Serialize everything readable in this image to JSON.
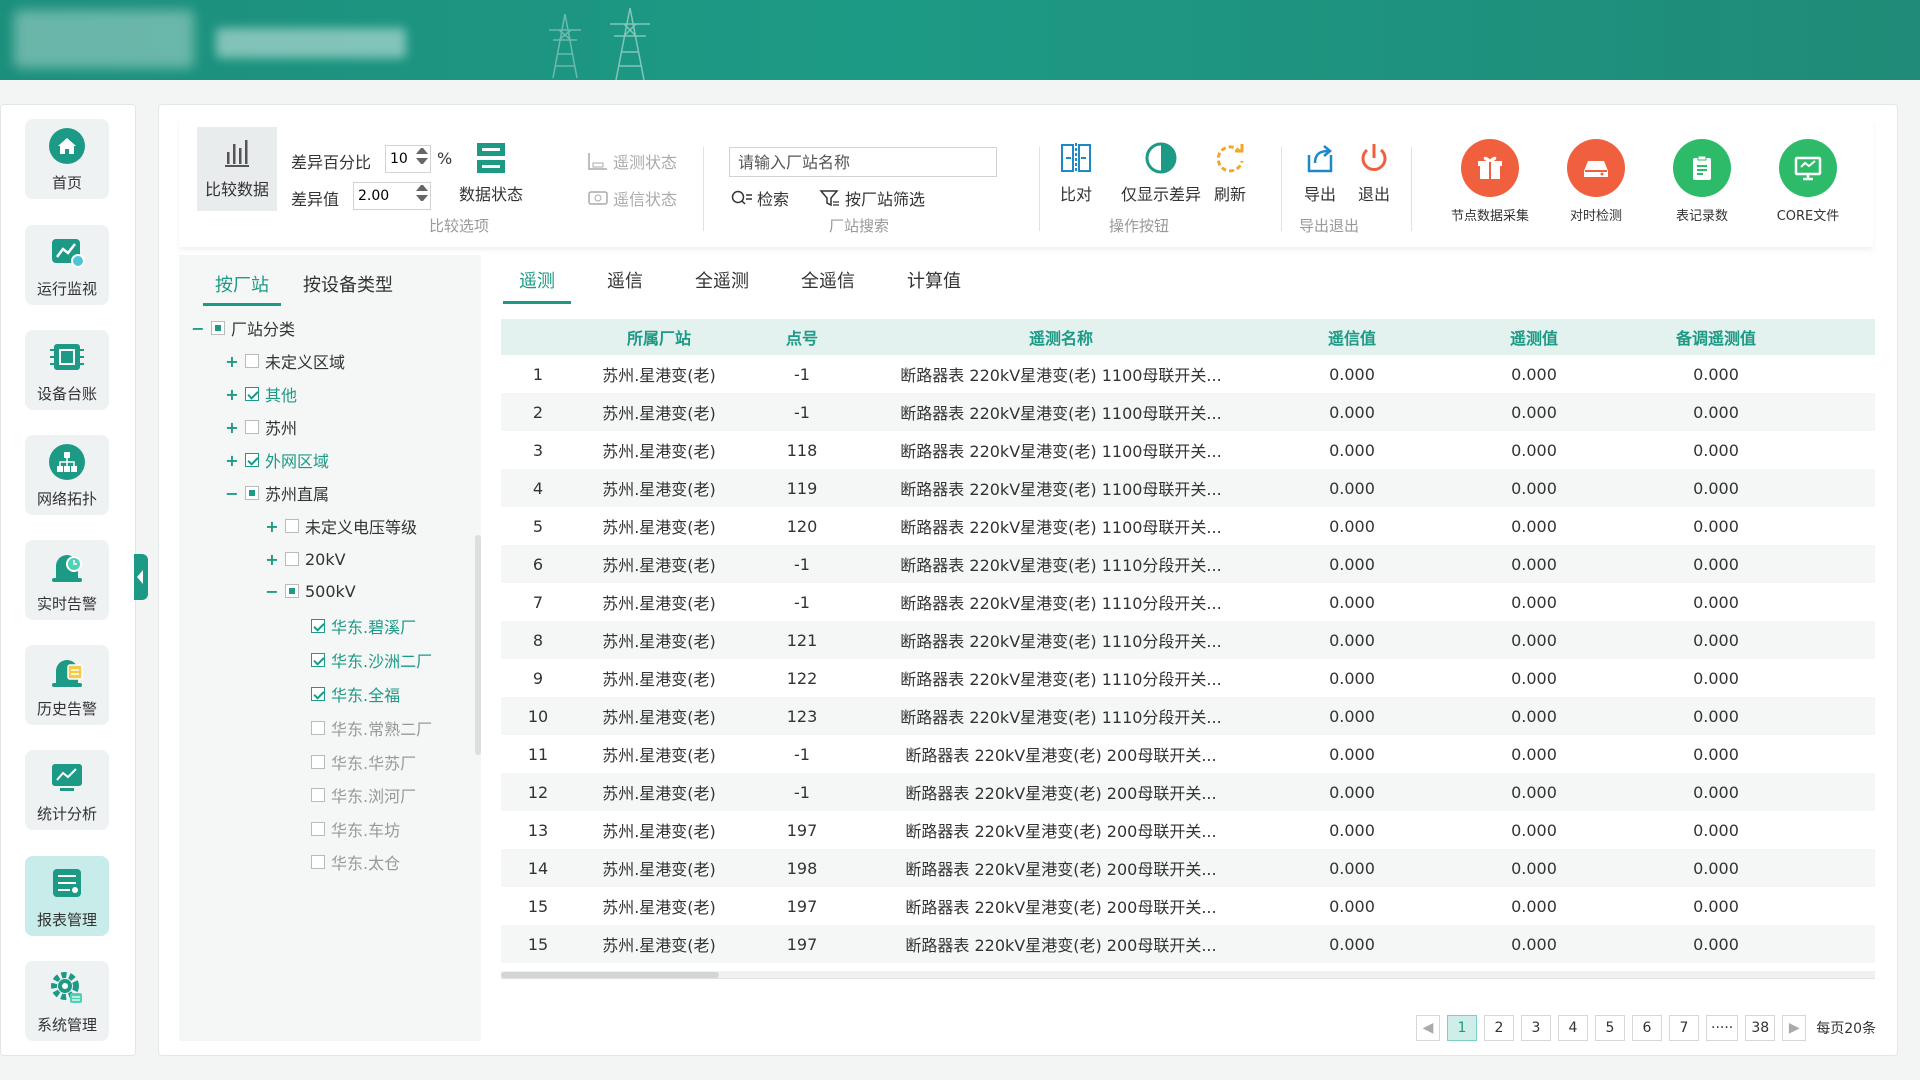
{
  "nav": [
    {
      "label": "首页",
      "icon": "home-icon"
    },
    {
      "label": "运行监视",
      "icon": "monitor-chart-icon"
    },
    {
      "label": "设备台账",
      "icon": "chip-icon"
    },
    {
      "label": "网络拓扑",
      "icon": "topology-icon"
    },
    {
      "label": "实时告警",
      "icon": "alarm-clock-icon"
    },
    {
      "label": "历史告警",
      "icon": "alarm-history-icon"
    },
    {
      "label": "统计分析",
      "icon": "statistics-icon"
    },
    {
      "label": "报表管理",
      "icon": "report-icon"
    },
    {
      "label": "系统管理",
      "icon": "settings-gear-icon"
    }
  ],
  "nav_active": "报表管理",
  "toolbar": {
    "compare_data": "比较数据",
    "diff_percent_label": "差异百分比",
    "diff_percent_value": "10",
    "percent_sign": "%",
    "diff_value_label": "差异值",
    "diff_value_value": "2.00",
    "data_status": "数据状态",
    "telemetry_status": "遥测状态",
    "telesignal_status": "遥信状态",
    "group_compare_options": "比较选项",
    "search_placeholder": "请输入厂站名称",
    "search_button": "检索",
    "filter_button": "按厂站筛选",
    "group_station_search": "厂站搜索",
    "compare": "比对",
    "show_diff_only": "仅显示差异",
    "refresh": "刷新",
    "group_actions": "操作按钮",
    "export": "导出",
    "exit": "退出",
    "group_export_exit": "导出退出",
    "node_data_collect": "节点数据采集",
    "time_sync_check": "对时检测",
    "table_record_count": "表记录数",
    "core_file": "CORE文件"
  },
  "colors": {
    "brand": "#1d9a85",
    "orange_red": "#f0603f",
    "green": "#2dbb6a"
  },
  "tree": {
    "tabs": [
      "按厂站",
      "按设备类型"
    ],
    "active_tab": "按厂站",
    "nodes": [
      {
        "label": "厂站分类",
        "expander": "−",
        "check": "partial",
        "style": "normal"
      },
      {
        "label": "未定义区域",
        "expander": "+",
        "check": "none",
        "style": "normal"
      },
      {
        "label": "其他",
        "expander": "+",
        "check": "checked",
        "style": "green"
      },
      {
        "label": "苏州",
        "expander": "+",
        "check": "none",
        "style": "normal"
      },
      {
        "label": "外网区域",
        "expander": "+",
        "check": "checked",
        "style": "green"
      },
      {
        "label": "苏州直属",
        "expander": "−",
        "check": "partial",
        "style": "normal"
      },
      {
        "label": "未定义电压等级",
        "expander": "+",
        "check": "none",
        "style": "normal"
      },
      {
        "label": "20kV",
        "expander": "+",
        "check": "none",
        "style": "normal"
      },
      {
        "label": "500kV",
        "expander": "−",
        "check": "partial",
        "style": "normal"
      },
      {
        "label": "华东.碧溪厂",
        "expander": "",
        "check": "checked",
        "style": "green"
      },
      {
        "label": "华东.沙洲二厂",
        "expander": "",
        "check": "checked",
        "style": "green"
      },
      {
        "label": "华东.全福",
        "expander": "",
        "check": "checked",
        "style": "green"
      },
      {
        "label": "华东.常熟二厂",
        "expander": "",
        "check": "none",
        "style": "gray"
      },
      {
        "label": "华东.华苏厂",
        "expander": "",
        "check": "none",
        "style": "gray"
      },
      {
        "label": "华东.浏河厂",
        "expander": "",
        "check": "none",
        "style": "gray"
      },
      {
        "label": "华东.车坊",
        "expander": "",
        "check": "none",
        "style": "gray"
      },
      {
        "label": "华东.太仓",
        "expander": "",
        "check": "none",
        "style": "gray"
      }
    ]
  },
  "data_tabs": [
    "遥测",
    "遥信",
    "全遥测",
    "全遥信",
    "计算值"
  ],
  "active_data_tab": "遥测",
  "table": {
    "columns": [
      "",
      "所属厂站",
      "点号",
      "遥测名称",
      "遥信值",
      "遥测值",
      "备调遥测值"
    ],
    "rows": [
      [
        "1",
        "苏州.星港变(老)",
        "-1",
        "断路器表 220kV星港变(老) 1100母联开关...",
        "0.000",
        "0.000",
        "0.000"
      ],
      [
        "2",
        "苏州.星港变(老)",
        "-1",
        "断路器表 220kV星港变(老) 1100母联开关...",
        "0.000",
        "0.000",
        "0.000"
      ],
      [
        "3",
        "苏州.星港变(老)",
        "118",
        "断路器表 220kV星港变(老) 1100母联开关...",
        "0.000",
        "0.000",
        "0.000"
      ],
      [
        "4",
        "苏州.星港变(老)",
        "119",
        "断路器表 220kV星港变(老) 1100母联开关...",
        "0.000",
        "0.000",
        "0.000"
      ],
      [
        "5",
        "苏州.星港变(老)",
        "120",
        "断路器表 220kV星港变(老) 1100母联开关...",
        "0.000",
        "0.000",
        "0.000"
      ],
      [
        "6",
        "苏州.星港变(老)",
        "-1",
        "断路器表 220kV星港变(老) 1110分段开关...",
        "0.000",
        "0.000",
        "0.000"
      ],
      [
        "7",
        "苏州.星港变(老)",
        "-1",
        "断路器表 220kV星港变(老) 1110分段开关...",
        "0.000",
        "0.000",
        "0.000"
      ],
      [
        "8",
        "苏州.星港变(老)",
        "121",
        "断路器表 220kV星港变(老) 1110分段开关...",
        "0.000",
        "0.000",
        "0.000"
      ],
      [
        "9",
        "苏州.星港变(老)",
        "122",
        "断路器表 220kV星港变(老) 1110分段开关...",
        "0.000",
        "0.000",
        "0.000"
      ],
      [
        "10",
        "苏州.星港变(老)",
        "123",
        "断路器表 220kV星港变(老) 1110分段开关...",
        "0.000",
        "0.000",
        "0.000"
      ],
      [
        "11",
        "苏州.星港变(老)",
        "-1",
        "断路器表 220kV星港变(老) 200母联开关...",
        "0.000",
        "0.000",
        "0.000"
      ],
      [
        "12",
        "苏州.星港变(老)",
        "-1",
        "断路器表 220kV星港变(老) 200母联开关...",
        "0.000",
        "0.000",
        "0.000"
      ],
      [
        "13",
        "苏州.星港变(老)",
        "197",
        "断路器表 220kV星港变(老) 200母联开关...",
        "0.000",
        "0.000",
        "0.000"
      ],
      [
        "14",
        "苏州.星港变(老)",
        "198",
        "断路器表 220kV星港变(老) 200母联开关...",
        "0.000",
        "0.000",
        "0.000"
      ],
      [
        "15",
        "苏州.星港变(老)",
        "197",
        "断路器表 220kV星港变(老) 200母联开关...",
        "0.000",
        "0.000",
        "0.000"
      ],
      [
        "15",
        "苏州.星港变(老)",
        "197",
        "断路器表 220kV星港变(老) 200母联开关...",
        "0.000",
        "0.000",
        "0.000"
      ]
    ]
  },
  "pager": {
    "prev": "◀",
    "pages": [
      "1",
      "2",
      "3",
      "4",
      "5",
      "6",
      "7",
      "·····",
      "38"
    ],
    "active_page": "1",
    "next": "▶",
    "page_size_label": "每页20条"
  }
}
